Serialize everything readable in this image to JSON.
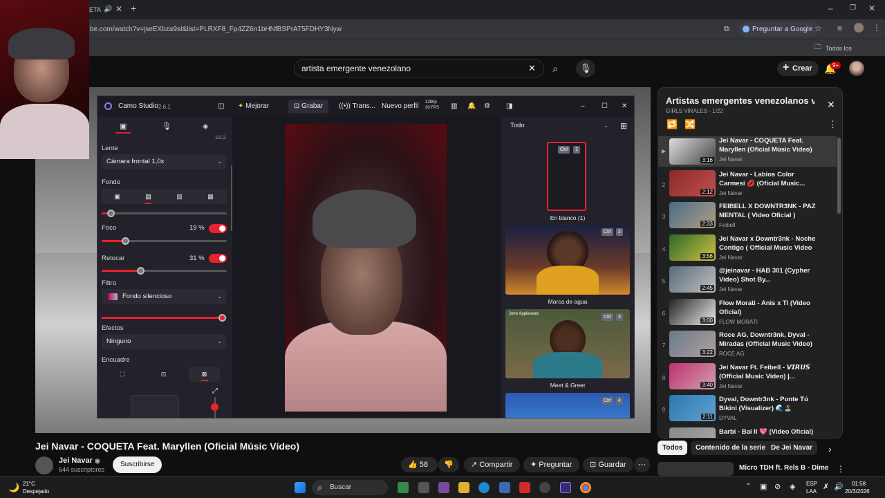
{
  "browser": {
    "url": "be.com/watch?v=jseEXbza9sI&list=PLRXF8_Fp4ZZ6n1bHNfBSPrAT5FDHY3Nyw",
    "tab_partial": "ETA",
    "google_button": "Preguntar a Google",
    "bookmarks_label": "Todos los marcadores"
  },
  "youtube": {
    "search_value": "artista emergente venezolano",
    "create_label": "Crear",
    "notif_badge": "9+",
    "video_title": "Jei Navar - COQUETA Feat. Maryllen (Oficial Músic Vídeo)",
    "channel_name": "Jei Navar",
    "channel_subs": "644 suscriptores",
    "subscribe_label": "Suscribirse",
    "likes": "58",
    "share_label": "Compartir",
    "ask_label": "Preguntar",
    "save_label": "Guardar"
  },
  "playlist": {
    "title": "Artistas emergentes venezolanos ve...",
    "subtitle": "GIRLS VIRALES - 1/22",
    "items": [
      {
        "num": "▶",
        "title": "Jei Navar - COQUETA Feat. Maryllen (Oficial Músic Vídeo)",
        "channel": "Jei Navar",
        "duration": "3:16"
      },
      {
        "num": "2",
        "title": "Jei Navar - Labios Color Carmesí 💋 (Oficial Music...",
        "channel": "Jei Navar",
        "duration": "2:12"
      },
      {
        "num": "3",
        "title": "FEIBELL X DOWNTR3NK - PAZ MENTAL ( Video Oficial )",
        "channel": "Feibell",
        "duration": "2:33"
      },
      {
        "num": "4",
        "title": "Jei Navar x Downtr3nk - Noche Contigo ( Official Music Video )",
        "channel": "Jei Navar",
        "duration": "3:56"
      },
      {
        "num": "5",
        "title": "@jeinavar - HAB 301 (Cypher Video) Shot By...",
        "channel": "Jei Navar",
        "duration": "2:45"
      },
      {
        "num": "6",
        "title": "Flow Morati - Anis x Ti (Video Oficial)",
        "channel": "FLOW MORATI",
        "duration": "3:00"
      },
      {
        "num": "7",
        "title": "Roce AG, Downtr3nk, Dyval - Miradas (Official Music Video)",
        "channel": "ROCE AG",
        "duration": "3:22"
      },
      {
        "num": "8",
        "title": "Jei Navar Ft. Feibell - 𝙑𝙄𝙍𝙐𝙎 (Official Music Video) |...",
        "channel": "Jei Navar",
        "duration": "3:40"
      },
      {
        "num": "9",
        "title": "Dyval, Downtr3nk - Ponte Tú Bikini (Visualizer) 🌊🏝️",
        "channel": "DYVAL",
        "duration": "2:11"
      },
      {
        "num": "",
        "title": "Barbi - Bai II 💖 (Video Oficial)",
        "channel": "",
        "duration": ""
      }
    ]
  },
  "chips": {
    "all": "Todos",
    "series": "Contenido de la serie",
    "from": "De Jei Navar"
  },
  "next_video": "Micro TDH ft. Rels B - Dime",
  "camo": {
    "app_name": "Camo Studio",
    "version": "2.6.1",
    "improve": "Mejorar",
    "record": "Grabar",
    "stream": "Trans...",
    "new_profile": "Nuevo perfil",
    "res": "1280p",
    "fps": "30 FPS",
    "lens_label": "Lente",
    "lens_value": "Cámara frontal 1,0x",
    "bg_label": "Fondo",
    "focus_label": "Foco",
    "focus_pct": "19 %",
    "focus_value": 0.19,
    "retouch_label": "Retocar",
    "retouch_pct": "31 %",
    "retouch_value": 0.31,
    "filter_label": "Filtro",
    "filter_value": "Fondo silencioso",
    "effects_label": "Efectos",
    "effects_value": "Ninguno",
    "framing_label": "Encuadre",
    "scene_filter": "Todo",
    "scenes": [
      {
        "label": "En blanco (1)",
        "key": "1"
      },
      {
        "label": "Marca de agua",
        "key": "2"
      },
      {
        "label": "Meet & Greet",
        "key": "3"
      },
      {
        "label": "",
        "key": "4"
      }
    ],
    "ctrl": "Ctrl",
    "meet_name": "John Appleseed",
    "zoom_hint": "1/2,2"
  },
  "taskbar": {
    "temp": "21°C",
    "weather": "Despejado",
    "search": "Buscar",
    "lang1": "ESP",
    "lang2": "LAA",
    "time": "01:58",
    "date": "20/3/2026"
  }
}
